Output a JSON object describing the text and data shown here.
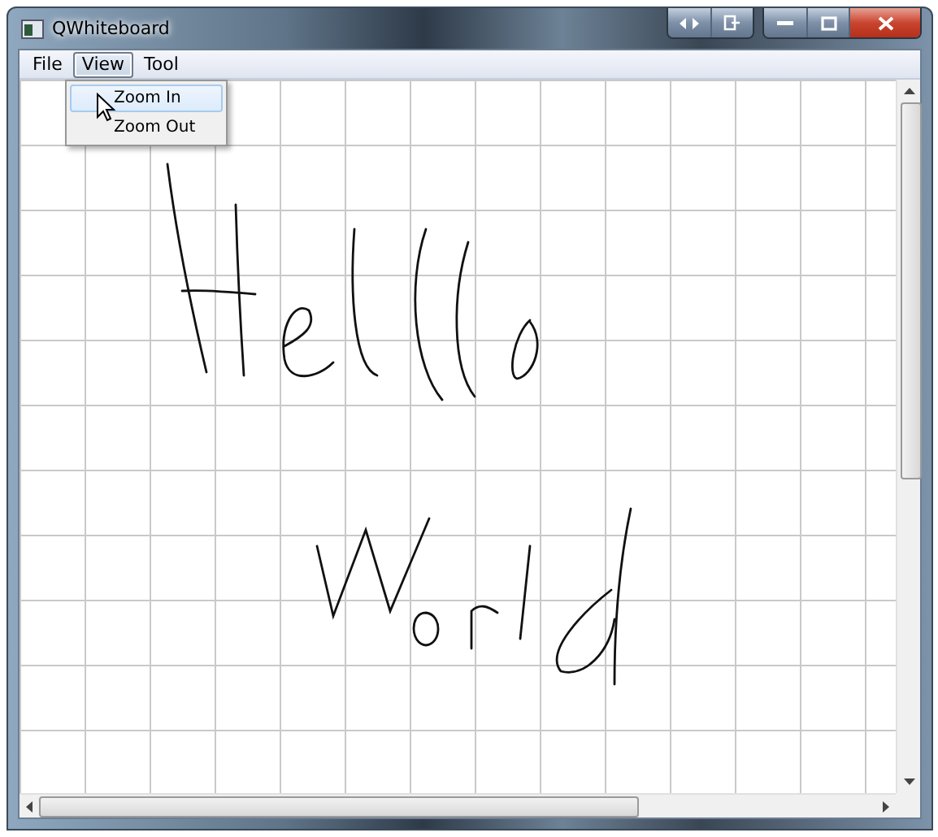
{
  "window": {
    "title": "QWhiteboard"
  },
  "menus": [
    {
      "label": "File",
      "selected": false
    },
    {
      "label": "View",
      "selected": true
    },
    {
      "label": "Tool",
      "selected": false
    }
  ],
  "dropdown": {
    "items": [
      {
        "label": "Zoom In",
        "selected": true
      },
      {
        "label": "Zoom Out",
        "selected": false
      }
    ]
  }
}
